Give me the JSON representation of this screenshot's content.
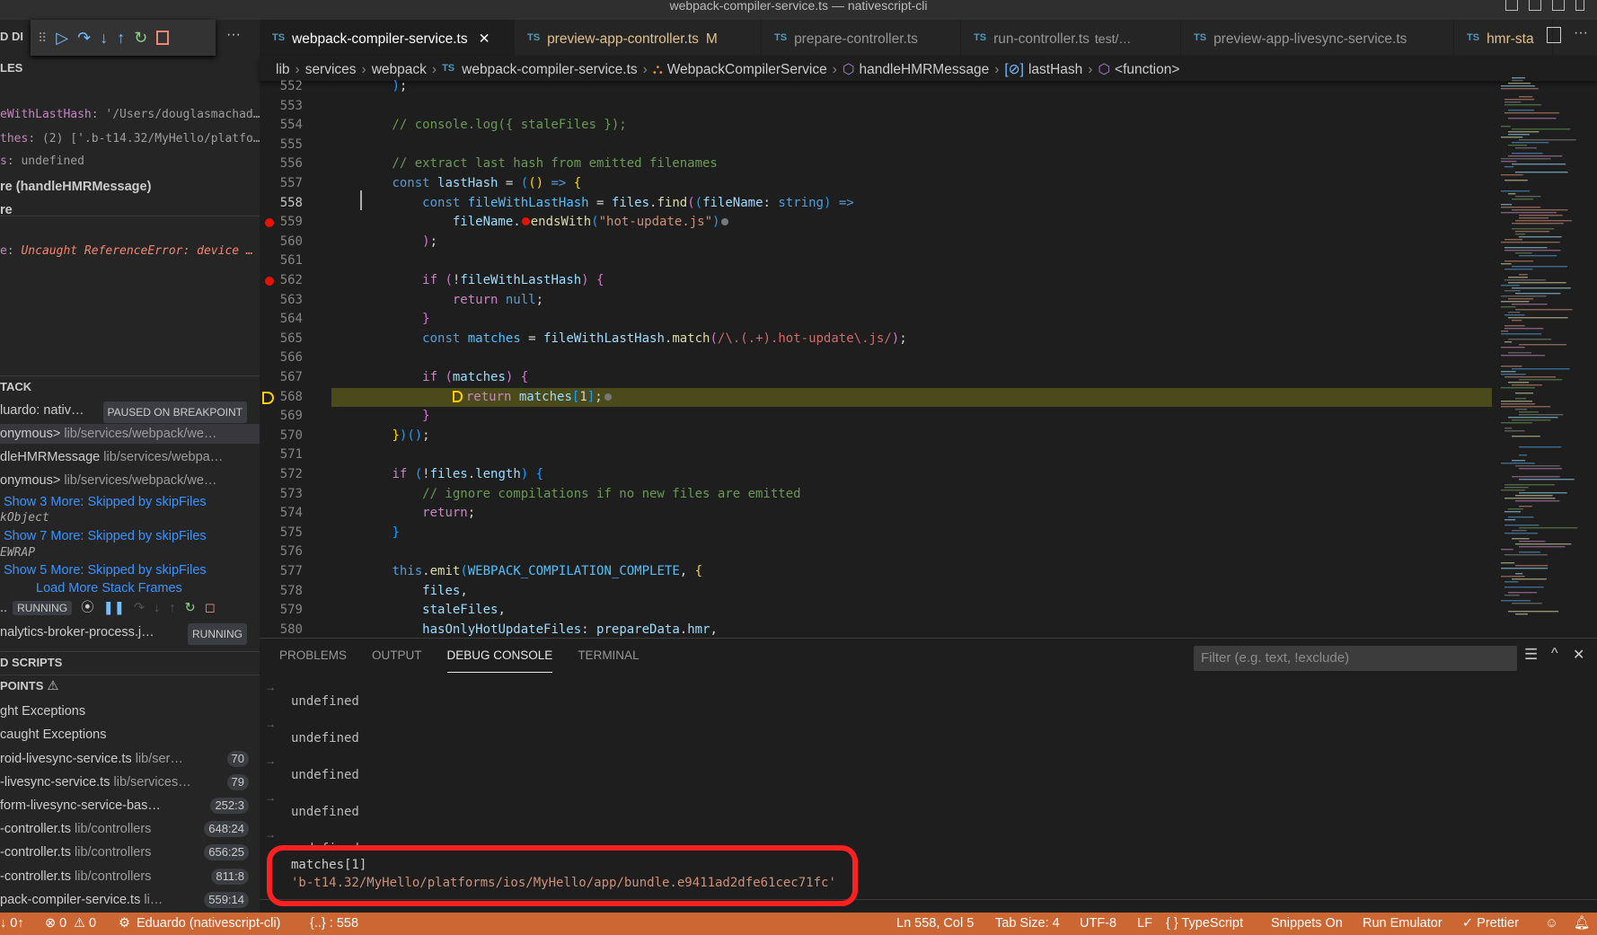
{
  "window": {
    "title": "webpack-compiler-service.ts — nativescript-cli"
  },
  "debug_toolbar": {
    "label": "D DI",
    "icons": [
      "drag-handle",
      "continue",
      "step-over",
      "step-into",
      "step-out",
      "restart",
      "stop"
    ],
    "more": "···"
  },
  "sidebar": {
    "variables_header": "LES",
    "variables": [
      {
        "name": "eWithLastHash",
        "value": ": '/Users/douglasmachad…"
      },
      {
        "name": "thes",
        "value": ": (2) ['.b-t14.32/MyHello/platfo…"
      },
      {
        "name": "s",
        "value": ": undefined"
      },
      {
        "scope": "re (handleHMRMessage)"
      },
      {
        "scope": "re"
      }
    ],
    "watch": [
      {
        "name": "e",
        "value": "Uncaught ReferenceError: device …"
      }
    ],
    "callstack_header": "TACK",
    "callstack": [
      {
        "name": "luardo: nativ…",
        "badge": "PAUSED ON BREAKPOINT"
      },
      {
        "name": "onymous>",
        "path": "lib/services/webpack/we…",
        "selected": true
      },
      {
        "name": "dleHMRMessage",
        "path": "lib/services/webpa…"
      },
      {
        "name": "onymous>",
        "path": "lib/services/webpack/we…"
      },
      {
        "link": "Show 3 More: Skipped by skipFiles"
      },
      {
        "italic": "kObject"
      },
      {
        "link": "Show 7 More: Skipped by skipFiles"
      },
      {
        "italic": "EWRAP"
      },
      {
        "link": "Show 5 More: Skipped by skipFiles"
      },
      {
        "load": "Load More Stack Frames"
      },
      {
        "name": "..",
        "badge": "RUNNING",
        "controls": true
      },
      {
        "name": "nalytics-broker-process.j…",
        "badge": "RUNNING"
      }
    ],
    "scripts_header": "D SCRIPTS",
    "breakpoints_header": "POINTS",
    "breakpoints": [
      {
        "name": "ght Exceptions"
      },
      {
        "name": "caught Exceptions"
      },
      {
        "name": "roid-livesync-service.ts",
        "path": "lib/ser…",
        "count": "70"
      },
      {
        "name": "-livesync-service.ts",
        "path": "lib/services…",
        "count": "79"
      },
      {
        "name": "form-livesync-service-bas…",
        "path": "",
        "count": "252:3"
      },
      {
        "name": "-controller.ts",
        "path": "lib/controllers",
        "count": "648:24"
      },
      {
        "name": "-controller.ts",
        "path": "lib/controllers",
        "count": "656:25"
      },
      {
        "name": "-controller.ts",
        "path": "lib/controllers",
        "count": "811:8"
      },
      {
        "name": "pack-compiler-service.ts",
        "path": "li…",
        "count": "559:14"
      }
    ]
  },
  "tabs": [
    {
      "label": "webpack-compiler-service.ts",
      "active": true,
      "close": "✕"
    },
    {
      "label": "preview-app-controller.ts",
      "modified": "M"
    },
    {
      "label": "prepare-controller.ts"
    },
    {
      "label": "run-controller.ts",
      "hint": "test/…"
    },
    {
      "label": "preview-app-livesync-service.ts"
    },
    {
      "label": "hmr-sta",
      "modified_color": true
    }
  ],
  "breadcrumb": [
    "lib",
    "services",
    "webpack",
    "webpack-compiler-service.ts",
    "WebpackCompilerService",
    "handleHMRMessage",
    "lastHash",
    "<function>"
  ],
  "editor": {
    "current_line": 558,
    "lines": [
      {
        "n": 552,
        "t": [
          [
            "        ",
            "p"
          ],
          [
            ")",
            "b3"
          ],
          [
            ";",
            "p"
          ]
        ]
      },
      {
        "n": 553,
        "t": []
      },
      {
        "n": 554,
        "t": [
          [
            "        // console.log({ staleFiles });",
            "c"
          ]
        ]
      },
      {
        "n": 555,
        "t": []
      },
      {
        "n": 556,
        "t": [
          [
            "        // extract last hash from emitted filenames",
            "c"
          ]
        ]
      },
      {
        "n": 557,
        "t": [
          [
            "        ",
            "p"
          ],
          [
            "const",
            "k"
          ],
          [
            " lastHash ",
            "v"
          ],
          [
            "= ",
            "p"
          ],
          [
            "(",
            "b3"
          ],
          [
            "()",
            "b1"
          ],
          [
            " => ",
            "k"
          ],
          [
            "{",
            "b1"
          ]
        ]
      },
      {
        "n": 558,
        "t": [
          [
            "            ",
            "p"
          ],
          [
            "const",
            "k"
          ],
          [
            " fileWithLastHash ",
            "cn"
          ],
          [
            "= ",
            "p"
          ],
          [
            "files",
            "v"
          ],
          [
            ".",
            "p"
          ],
          [
            "find",
            "f"
          ],
          [
            "(",
            "b2"
          ],
          [
            "(",
            "b3"
          ],
          [
            "fileName",
            "v"
          ],
          [
            ": ",
            "p"
          ],
          [
            "string",
            "k"
          ],
          [
            ")",
            "b3"
          ],
          [
            " =>",
            "k"
          ]
        ]
      },
      {
        "n": 559,
        "bp": true,
        "t": [
          [
            "                ",
            "p"
          ],
          [
            "fileName",
            "v"
          ],
          [
            ".",
            "p"
          ],
          [
            "",
            "dr"
          ],
          [
            "endsWith",
            "f"
          ],
          [
            "(",
            "b3"
          ],
          [
            "\"hot-update.js\"",
            "s"
          ],
          [
            ")",
            "b3"
          ],
          [
            "",
            "dg"
          ]
        ]
      },
      {
        "n": 560,
        "t": [
          [
            "            ",
            "p"
          ],
          [
            ")",
            "b2"
          ],
          [
            ";",
            "p"
          ]
        ]
      },
      {
        "n": 561,
        "t": []
      },
      {
        "n": 562,
        "bp": true,
        "t": [
          [
            "            ",
            "p"
          ],
          [
            "if",
            "ctl"
          ],
          [
            " (",
            "b2"
          ],
          [
            "!",
            "p"
          ],
          [
            "fileWithLastHash",
            "v"
          ],
          [
            ") ",
            "b2"
          ],
          [
            "{",
            "b2"
          ]
        ]
      },
      {
        "n": 563,
        "t": [
          [
            "                ",
            "p"
          ],
          [
            "return",
            "ctl"
          ],
          [
            " null",
            "k"
          ],
          [
            ";",
            "p"
          ]
        ]
      },
      {
        "n": 564,
        "t": [
          [
            "            ",
            "p"
          ],
          [
            "}",
            "b2"
          ]
        ]
      },
      {
        "n": 565,
        "t": [
          [
            "            ",
            "p"
          ],
          [
            "const",
            "k"
          ],
          [
            " matches ",
            "cn"
          ],
          [
            "= ",
            "p"
          ],
          [
            "fileWithLastHash",
            "v"
          ],
          [
            ".",
            "p"
          ],
          [
            "match",
            "f"
          ],
          [
            "(",
            "b2"
          ],
          [
            "/\\.(.+).hot-update\\.js/",
            "re"
          ],
          [
            ")",
            "b2"
          ],
          [
            ";",
            "p"
          ]
        ]
      },
      {
        "n": 566,
        "t": []
      },
      {
        "n": 567,
        "t": [
          [
            "            ",
            "p"
          ],
          [
            "if",
            "ctl"
          ],
          [
            " (",
            "b2"
          ],
          [
            "matches",
            "v"
          ],
          [
            ") ",
            "b2"
          ],
          [
            "{",
            "b2"
          ]
        ]
      },
      {
        "n": 568,
        "paused": true,
        "t": [
          [
            "                ",
            "p"
          ],
          [
            "",
            "arr"
          ],
          [
            "return",
            "ctl"
          ],
          [
            " matches",
            "v"
          ],
          [
            "[",
            "b3"
          ],
          [
            "1",
            "p"
          ],
          [
            "]",
            "b3"
          ],
          [
            ";",
            "p"
          ],
          [
            "",
            "dg"
          ]
        ]
      },
      {
        "n": 569,
        "t": [
          [
            "            ",
            "p"
          ],
          [
            "}",
            "b2"
          ]
        ]
      },
      {
        "n": 570,
        "t": [
          [
            "        ",
            "p"
          ],
          [
            "}",
            "b1"
          ],
          [
            ")",
            "b3"
          ],
          [
            "()",
            "b3"
          ],
          [
            ";",
            "p"
          ]
        ]
      },
      {
        "n": 571,
        "t": []
      },
      {
        "n": 572,
        "t": [
          [
            "        ",
            "p"
          ],
          [
            "if",
            "ctl"
          ],
          [
            " (",
            "b3"
          ],
          [
            "!",
            "p"
          ],
          [
            "files",
            "v"
          ],
          [
            ".",
            "p"
          ],
          [
            "length",
            "v"
          ],
          [
            ") ",
            "b3"
          ],
          [
            "{",
            "b3"
          ]
        ]
      },
      {
        "n": 573,
        "t": [
          [
            "            // ignore compilations if no new files are emitted",
            "c"
          ]
        ]
      },
      {
        "n": 574,
        "t": [
          [
            "            ",
            "p"
          ],
          [
            "return",
            "ctl"
          ],
          [
            ";",
            "p"
          ]
        ]
      },
      {
        "n": 575,
        "t": [
          [
            "        ",
            "p"
          ],
          [
            "}",
            "b3"
          ]
        ]
      },
      {
        "n": 576,
        "t": []
      },
      {
        "n": 577,
        "t": [
          [
            "        ",
            "p"
          ],
          [
            "this",
            "k"
          ],
          [
            ".",
            "p"
          ],
          [
            "emit",
            "f"
          ],
          [
            "(",
            "b3"
          ],
          [
            "WEBPACK_COMPILATION_COMPLETE",
            "cn"
          ],
          [
            ", ",
            "p"
          ],
          [
            "{",
            "b1"
          ]
        ]
      },
      {
        "n": 578,
        "t": [
          [
            "            ",
            "p"
          ],
          [
            "files",
            "v"
          ],
          [
            ",",
            "p"
          ]
        ]
      },
      {
        "n": 579,
        "t": [
          [
            "            ",
            "p"
          ],
          [
            "staleFiles",
            "v"
          ],
          [
            ",",
            "p"
          ]
        ]
      },
      {
        "n": 580,
        "t": [
          [
            "            ",
            "p"
          ],
          [
            "hasOnlyHotUpdateFiles",
            "v"
          ],
          [
            ": ",
            "p"
          ],
          [
            "prepareData",
            "v"
          ],
          [
            ".",
            "p"
          ],
          [
            "hmr",
            "v"
          ],
          [
            ",",
            "p"
          ]
        ]
      }
    ]
  },
  "panel": {
    "tabs": [
      "PROBLEMS",
      "OUTPUT",
      "DEBUG CONSOLE",
      "TERMINAL"
    ],
    "active_tab": "DEBUG CONSOLE",
    "filter_placeholder": "Filter (e.g. text, !exclude)",
    "console": [
      "undefined",
      "undefined",
      "undefined",
      "undefined",
      "undefined"
    ],
    "expression": "matches[1]",
    "result": "'b-t14.32/MyHello/platforms/ios/MyHello/app/bundle.e9411ad2dfe61cec71fc'",
    "highlight_color": "#ff2020"
  },
  "status": {
    "sync": "↓ 0↑",
    "errors": "⊗ 0",
    "warnings": "⚠ 0",
    "debug_session": "Eduardo (nativescript-cli)",
    "scope": "{..} : 558",
    "position": "Ln 558, Col 5",
    "tab_size": "Tab Size: 4",
    "encoding": "UTF-8",
    "eol": "LF",
    "language": "{ } TypeScript",
    "snippets": "Snippets On",
    "emulator": "Run Emulator",
    "prettier": "✓ Prettier",
    "color": "#cc6633"
  }
}
